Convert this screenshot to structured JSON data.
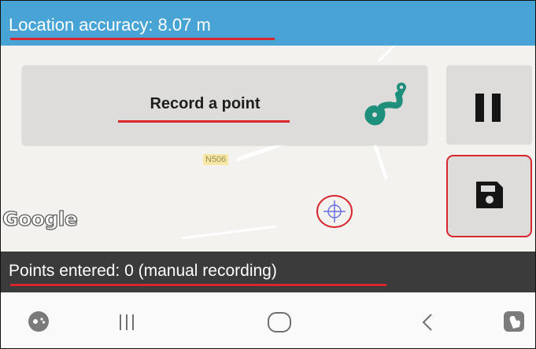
{
  "status": {
    "location_accuracy_text": "Location accuracy: 8.07 m",
    "points_entered_text": "Points entered: 0 (manual recording)"
  },
  "buttons": {
    "record_label": "Record a point",
    "pause_icon": "pause-icon",
    "save_icon": "floppy-disk-save-icon",
    "route_icon": "route-map-pin-icon"
  },
  "map": {
    "road_label": "N506",
    "attribution": "Google"
  },
  "nav": {
    "items": [
      "game-launcher-icon",
      "recent-apps-icon",
      "home-icon",
      "back-icon",
      "assistant-touch-icon"
    ]
  },
  "colors": {
    "top_bar": "#49a4d6",
    "status_bar": "#3b3b3b",
    "highlight_red": "#d8262e",
    "route_icon_green": "#1e8f7a",
    "button_grey": "#dddcda"
  }
}
